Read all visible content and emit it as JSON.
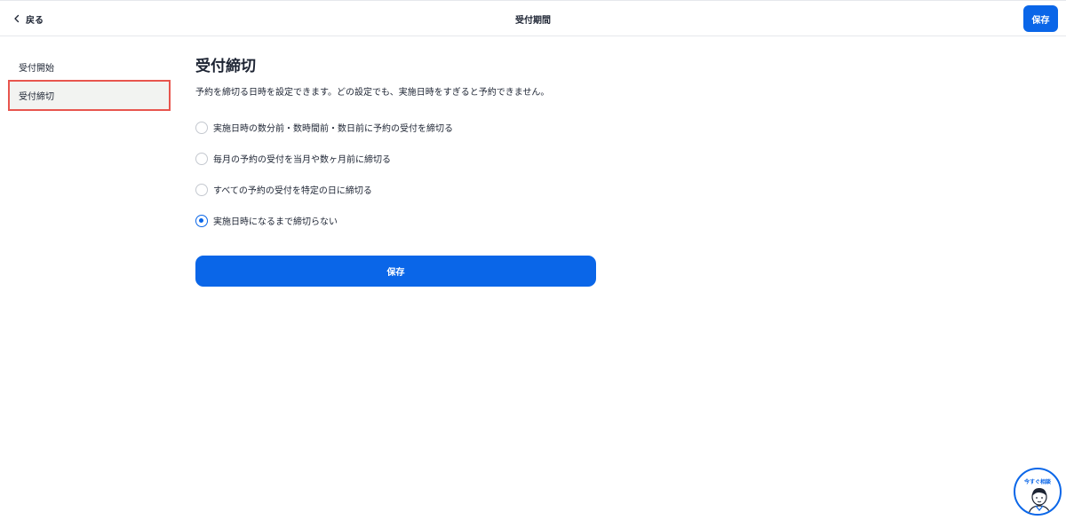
{
  "header": {
    "back_label": "戻る",
    "title": "受付期間",
    "save_label": "保存"
  },
  "sidebar": {
    "items": [
      {
        "label": "受付開始",
        "active": false
      },
      {
        "label": "受付締切",
        "active": true
      }
    ]
  },
  "main": {
    "title": "受付締切",
    "description": "予約を締切る日時を設定できます。どの設定でも、実施日時をすぎると予約できません。",
    "options": [
      {
        "label": "実施日時の数分前・数時間前・数日前に予約の受付を締切る",
        "checked": false
      },
      {
        "label": "毎月の予約の受付を当月や数ヶ月前に締切る",
        "checked": false
      },
      {
        "label": "すべての予約の受付を特定の日に締切る",
        "checked": false
      },
      {
        "label": "実施日時になるまで締切らない",
        "checked": true
      }
    ],
    "save_label": "保存"
  },
  "consult_widget": {
    "label": "今すぐ相談"
  },
  "colors": {
    "accent": "#0a66e8",
    "highlight_border": "#e8554e",
    "active_bg": "#f2f3f1"
  }
}
